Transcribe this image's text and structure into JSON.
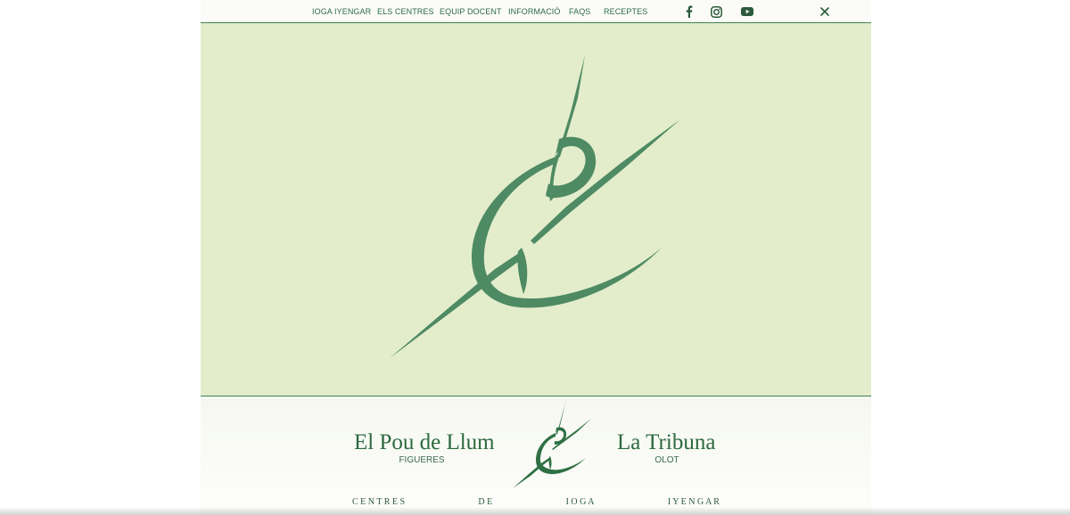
{
  "nav": {
    "items": [
      {
        "label": "IOGA IYENGAR"
      },
      {
        "label": "ELS CENTRES"
      },
      {
        "label": "EQUIP DOCENT"
      },
      {
        "label": "INFORMACIÓ"
      },
      {
        "label": "FAQS"
      },
      {
        "label": "RECEPTES"
      }
    ],
    "social": [
      "facebook-icon",
      "instagram-icon",
      "youtube-icon"
    ],
    "close_icon": "close-icon"
  },
  "hero": {
    "logo": "iyengar-figure-logo",
    "background": "#e3edcb",
    "accent": "#4e8a63"
  },
  "footer": {
    "left_center": {
      "name": "El Pou de Llum",
      "city": "FIGUERES"
    },
    "right_center": {
      "name": "La Tribuna",
      "city": "OLOT"
    },
    "tagline_words": [
      "C E N T R E S",
      "D E",
      "I O G A",
      "I Y E N G A R"
    ]
  },
  "colors": {
    "brand_green": "#2c6a3f",
    "line_green": "#3f7f52"
  }
}
